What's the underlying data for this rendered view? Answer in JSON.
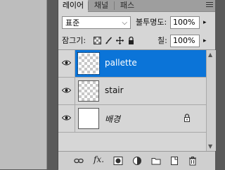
{
  "tabs": [
    {
      "label": "레이어"
    },
    {
      "label": "채널"
    },
    {
      "label": "패스"
    }
  ],
  "blend_mode": {
    "value": "표준"
  },
  "opacity": {
    "label": "불투명도:",
    "value": "100%"
  },
  "lock": {
    "label": "잠그기:"
  },
  "fill": {
    "label": "칠:",
    "value": "100%"
  },
  "layers": [
    {
      "name": "pallette",
      "selected": true,
      "visible": true,
      "thumbnail": "transparent"
    },
    {
      "name": "stair",
      "selected": false,
      "visible": true,
      "thumbnail": "transparent"
    },
    {
      "name": "배경",
      "selected": false,
      "visible": true,
      "thumbnail": "white",
      "locked": true
    }
  ],
  "colors": {
    "selection": "#0b74d8",
    "panel": "#d6d6d6"
  }
}
